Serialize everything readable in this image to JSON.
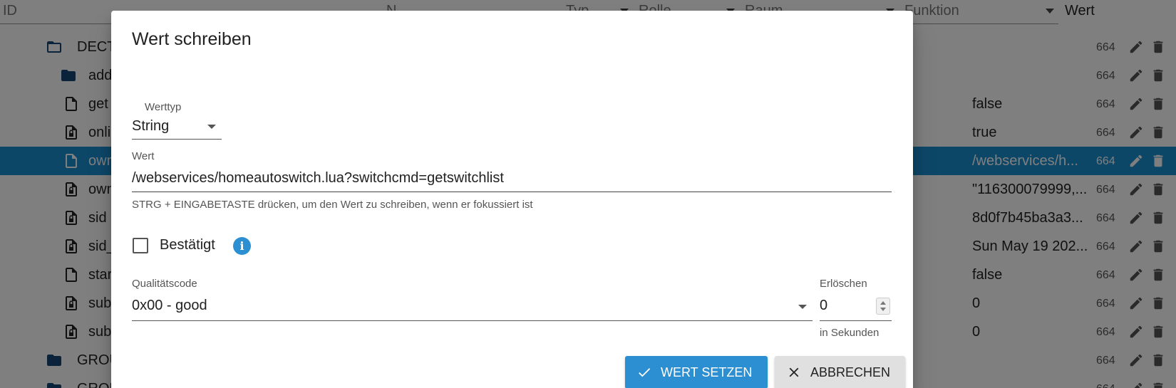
{
  "background": {
    "columns": [
      {
        "name": "col-id",
        "label": "ID"
      },
      {
        "name": "col-name",
        "label": "N"
      },
      {
        "name": "col-type",
        "label": "Typ"
      },
      {
        "name": "col-role",
        "label": "Rolle"
      },
      {
        "name": "col-room",
        "label": "Raum"
      },
      {
        "name": "col-function",
        "label": "Funktion"
      },
      {
        "name": "col-value",
        "label": "Wert"
      }
    ],
    "rows": [
      {
        "name": "DECT_",
        "value": "",
        "acl": "664",
        "icon": "folder-open-icon"
      },
      {
        "name": "add",
        "value": "",
        "acl": "664",
        "icon": "folder-icon"
      },
      {
        "name": "get",
        "value": "false",
        "acl": "664",
        "icon": "file-icon"
      },
      {
        "name": "onli",
        "value": "true",
        "acl": "664",
        "icon": "file-lock-icon"
      },
      {
        "name": "own",
        "value": "/webservices/h...",
        "acl": "664",
        "icon": "file-icon",
        "selected": true
      },
      {
        "name": "own",
        "value": "\"116300079999,...",
        "acl": "664",
        "icon": "file-lock-icon"
      },
      {
        "name": "sid",
        "value": "8d0f7b45ba3a3...",
        "acl": "664",
        "icon": "file-lock-icon"
      },
      {
        "name": "sid_",
        "value": "Sun May 19 202...",
        "acl": "664",
        "icon": "file-lock-icon"
      },
      {
        "name": "star",
        "value": "false",
        "acl": "664",
        "icon": "file-icon"
      },
      {
        "name": "sub",
        "value": "0",
        "acl": "664",
        "icon": "file-lock-icon"
      },
      {
        "name": "sub",
        "value": "0",
        "acl": "664",
        "icon": "file-lock-icon"
      },
      {
        "name": "GROU",
        "value": "",
        "acl": "664",
        "icon": "folder-icon"
      },
      {
        "name": "GROU",
        "value": "",
        "acl": "664",
        "icon": "folder-icon"
      }
    ]
  },
  "dialog": {
    "title": "Wert schreiben",
    "type_label": "Werttyp",
    "type_value": "String",
    "value_label": "Wert",
    "value": "/webservices/homeautoswitch.lua?switchcmd=getswitchlist",
    "helper": "STRG + EINGABETASTE drücken, um den Wert zu schreiben, wenn er fokussiert ist",
    "ack_label": "Bestätigt",
    "quality_label": "Qualitätscode",
    "quality_value": "0x00 - good",
    "expire_label": "Erlöschen",
    "expire_value": "0",
    "expire_unit": "in Sekunden",
    "submit_label": "WERT SETZEN",
    "cancel_label": "ABBRECHEN"
  },
  "colors": {
    "accent": "#2b8fd1",
    "selected_row": "#1a8fd0",
    "folder": "#164477",
    "overlay": "rgba(0,0,0,0.5)"
  }
}
